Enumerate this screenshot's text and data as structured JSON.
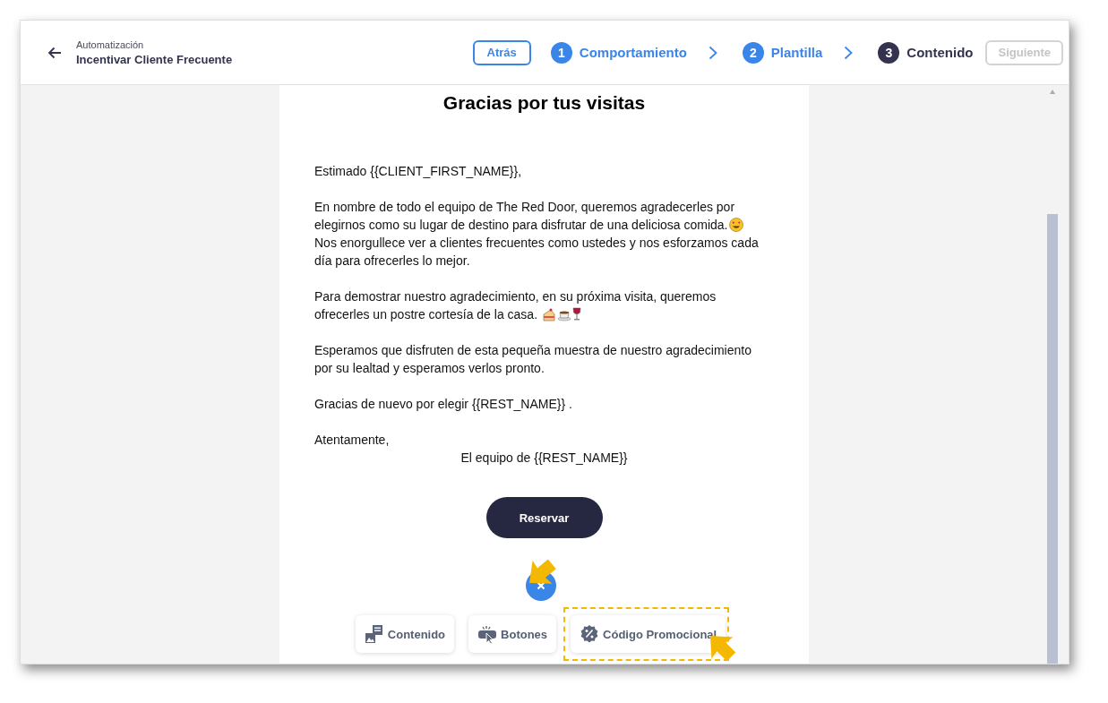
{
  "header": {
    "breadcrumb": "Automatización",
    "title": "Incentivar Cliente Frecuente"
  },
  "back_button": "Atrás",
  "steps": [
    {
      "number": "1",
      "label": "Comportamiento",
      "completed": true
    },
    {
      "number": "2",
      "label": "Plantilla",
      "completed": true
    },
    {
      "number": "3",
      "label": "Contenido",
      "completed": false
    }
  ],
  "next_button": {
    "label": "Siguiente",
    "disabled": true
  },
  "email": {
    "heading": "Gracias por tus visitas",
    "paragraphs": [
      [
        "Estimado {{CLIENT_FIRST_NAME}},"
      ],
      [
        "En nombre de todo el equipo de The Red Door, queremos agradecerles por",
        "elegirnos como su lugar de destino para disfrutar de una deliciosa comida.",
        "Nos enorgullece ver a clientes frecuentes como ustedes y nos esforzamos cada",
        "día para ofrecerles lo mejor."
      ],
      [
        "Para demostrar nuestro agradecimiento, en su próxima visita, queremos",
        "ofrecerles un postre cortesía de la casa."
      ],
      [
        "Esperamos que disfruten de esta pequeña muestra de nuestro agradecimiento",
        "por su lealtad y esperamos verlos pronto."
      ],
      [
        "Gracias de nuevo por elegir {{REST_NAME}} ."
      ],
      [
        "Atentamente,"
      ]
    ],
    "signature": "El equipo de {{REST_NAME}}",
    "cta_button": "Reservar"
  },
  "toolbar": [
    {
      "kind": "content",
      "label": "Contenido",
      "highlighted": false
    },
    {
      "kind": "buttons",
      "label": "Botones",
      "highlighted": false
    },
    {
      "kind": "promo",
      "label": "Código Promocional",
      "highlighted": true
    }
  ]
}
